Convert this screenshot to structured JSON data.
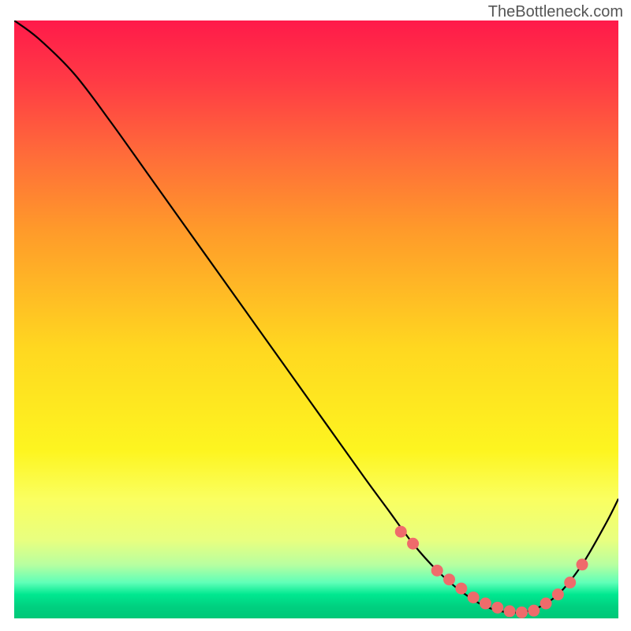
{
  "watermark": "TheBottleneck.com",
  "chart_data": {
    "type": "line",
    "title": "",
    "xlabel": "",
    "ylabel": "",
    "xlim": [
      0,
      100
    ],
    "ylim": [
      0,
      100
    ],
    "series": [
      {
        "name": "curve",
        "x": [
          0,
          4,
          10,
          16,
          22,
          28,
          34,
          40,
          46,
          52,
          58,
          62,
          66,
          70,
          74,
          78,
          82,
          86,
          90,
          94,
          98,
          100
        ],
        "y": [
          100,
          97,
          91,
          83,
          74.5,
          66,
          57.5,
          49,
          40.5,
          32,
          23.5,
          18,
          12.5,
          8,
          4.5,
          2,
          1,
          1.5,
          4,
          9,
          16,
          20
        ]
      }
    ],
    "markers": {
      "name": "data-points",
      "color": "#ef6b6b",
      "x": [
        64,
        66,
        70,
        72,
        74,
        76,
        78,
        80,
        82,
        84,
        86,
        88,
        90,
        92,
        94
      ],
      "y": [
        14.5,
        12.5,
        8,
        6.5,
        5,
        3.5,
        2.5,
        1.8,
        1.2,
        1.0,
        1.3,
        2.5,
        4,
        6,
        9
      ]
    },
    "background": "vertical-gradient-red-to-green"
  }
}
